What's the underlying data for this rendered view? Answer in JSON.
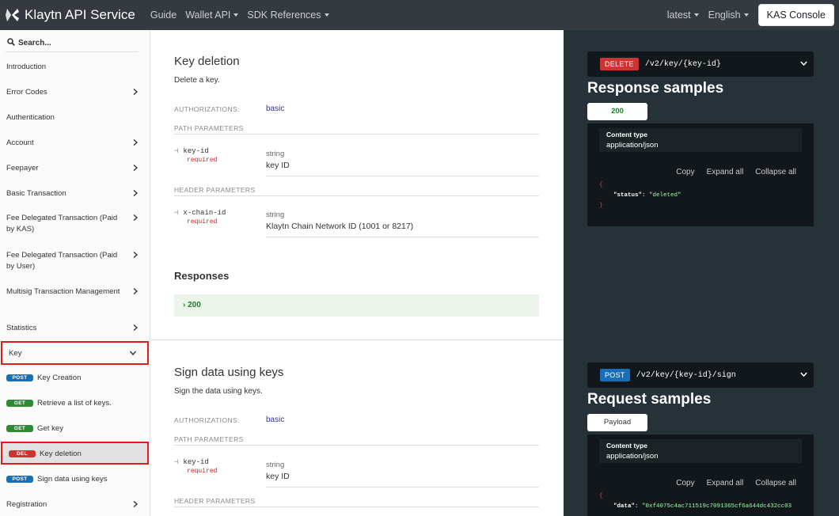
{
  "nav": {
    "brand": "Klaytn API Service",
    "links": [
      "Guide",
      "Wallet API",
      "SDK References"
    ],
    "version": "latest",
    "language": "English",
    "console_btn": "KAS Console"
  },
  "sidebar": {
    "search_placeholder": "Search...",
    "items": [
      "Introduction",
      "Error Codes",
      "Authentication",
      "Account",
      "Feepayer",
      "Basic Transaction",
      "Fee Delegated Transaction (Paid by KAS)",
      "Fee Delegated Transaction (Paid by User)",
      "Multisig Transaction Management",
      "Statistics",
      "Key"
    ],
    "sub_items": [
      {
        "method": "POST",
        "label": "Key Creation"
      },
      {
        "method": "GET",
        "label": "Retrieve a list of keys."
      },
      {
        "method": "GET",
        "label": "Get key"
      },
      {
        "method": "DEL",
        "label": "Key deletion"
      },
      {
        "method": "POST",
        "label": "Sign data using keys"
      }
    ],
    "last_item": "Registration"
  },
  "sections": [
    {
      "title": "Key deletion",
      "desc": "Delete a key.",
      "auth_label": "AUTHORIZATIONS:",
      "auth_value": "basic",
      "path_label": "PATH PARAMETERS",
      "path_param": {
        "name": "key-id",
        "req": "required",
        "type": "string",
        "desc": "key ID"
      },
      "header_label": "HEADER PARAMETERS",
      "header_param": {
        "name": "x-chain-id",
        "req": "required",
        "type": "string",
        "desc": "Klaytn Chain Network ID (1001 or 8217)"
      },
      "responses_title": "Responses",
      "response_code": "200"
    },
    {
      "title": "Sign data using keys",
      "desc": "Sign the data using keys.",
      "auth_label": "AUTHORIZATIONS:",
      "auth_value": "basic",
      "path_label": "PATH PARAMETERS",
      "path_param": {
        "name": "key-id",
        "req": "required",
        "type": "string",
        "desc": "key ID"
      },
      "header_label": "HEADER PARAMETERS"
    }
  ],
  "right": {
    "ep1": {
      "method": "DELETE",
      "path": "/v2/key/{key-id}"
    },
    "title1": "Response samples",
    "tab1": "200",
    "content_type_label": "Content type",
    "content_type_value": "application/json",
    "tools": [
      "Copy",
      "Expand all",
      "Collapse all"
    ],
    "code1": {
      "key": "\"status\"",
      "value": "\"deleted\""
    },
    "ep2": {
      "method": "POST",
      "path": "/v2/key/{key-id}/sign"
    },
    "title2": "Request samples",
    "tab2": "Payload",
    "code2": {
      "key": "\"data\"",
      "value": "\"0xf4075c4ac711519c7091365cf6a644dc432cc03"
    }
  },
  "colors": {
    "nav_bg": "#343a40",
    "right_bg": "#263238",
    "del": "#cc3333",
    "post": "#186fb8",
    "get": "#2d8a34",
    "highlight": "#e41b1b"
  }
}
